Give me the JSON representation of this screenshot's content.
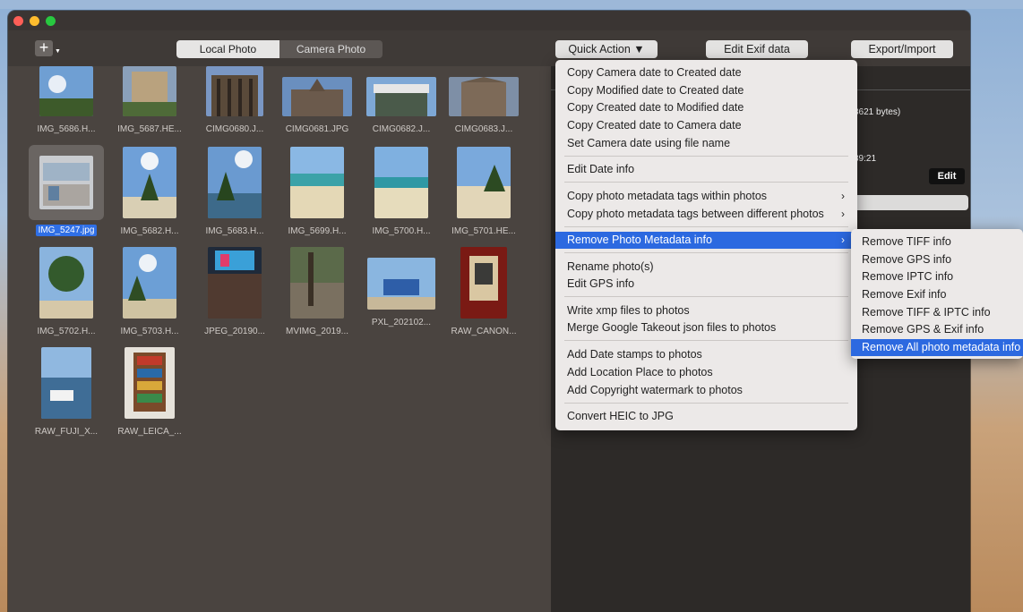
{
  "toolbar": {
    "add_label": "+",
    "tab_local": "Local Photo",
    "tab_camera": "Camera Photo",
    "quick_action": "Quick Action ▼",
    "edit_exif": "Edit Exif data",
    "export_import": "Export/Import"
  },
  "photos": [
    "IMG_5686.H...",
    "IMG_5687.HE...",
    "CIMG0680.J...",
    "CIMG0681.JPG",
    "CIMG0682.J...",
    "CIMG0683.J...",
    "IMG_5247.jpg",
    "IMG_5682.H...",
    "IMG_5683.H...",
    "IMG_5699.H...",
    "IMG_5700.H...",
    "IMG_5701.HE...",
    "IMG_5702.H...",
    "IMG_5703.H...",
    "JPEG_20190...",
    "MVIMG_2019...",
    "PXL_202102...",
    "RAW_CANON...",
    "RAW_FUJI_X...",
    "RAW_LEICA_..."
  ],
  "details": {
    "bytes": "3621 bytes)",
    "time": "39:21",
    "edit_label": "Edit"
  },
  "menu": {
    "items": [
      "Copy Camera date to Created date",
      "Copy Modified date to Created date",
      "Copy Created date to Modified date",
      "Copy Created date to Camera date",
      "Set Camera date using file name",
      "Edit Date info",
      "Copy photo metadata tags within photos",
      "Copy photo metadata tags between different photos",
      "Remove Photo Metadata info",
      "Rename photo(s)",
      "Edit GPS  info",
      "Write xmp files to photos",
      "Merge Google Takeout json files to photos",
      "Add Date stamps to photos",
      "Add Location Place to photos",
      "Add Copyright watermark to photos",
      "Convert HEIC to JPG"
    ],
    "arrow": "›"
  },
  "submenu": {
    "items": [
      "Remove TIFF info",
      "Remove GPS info",
      "Remove IPTC info",
      "Remove Exif info",
      "Remove TIFF & IPTC info",
      "Remove GPS & Exif info",
      "Remove All photo metadata info"
    ]
  },
  "colors": {
    "highlight": "#2c69e0",
    "window_bg": "#4a4440",
    "menu_bg": "#ece9e8"
  }
}
